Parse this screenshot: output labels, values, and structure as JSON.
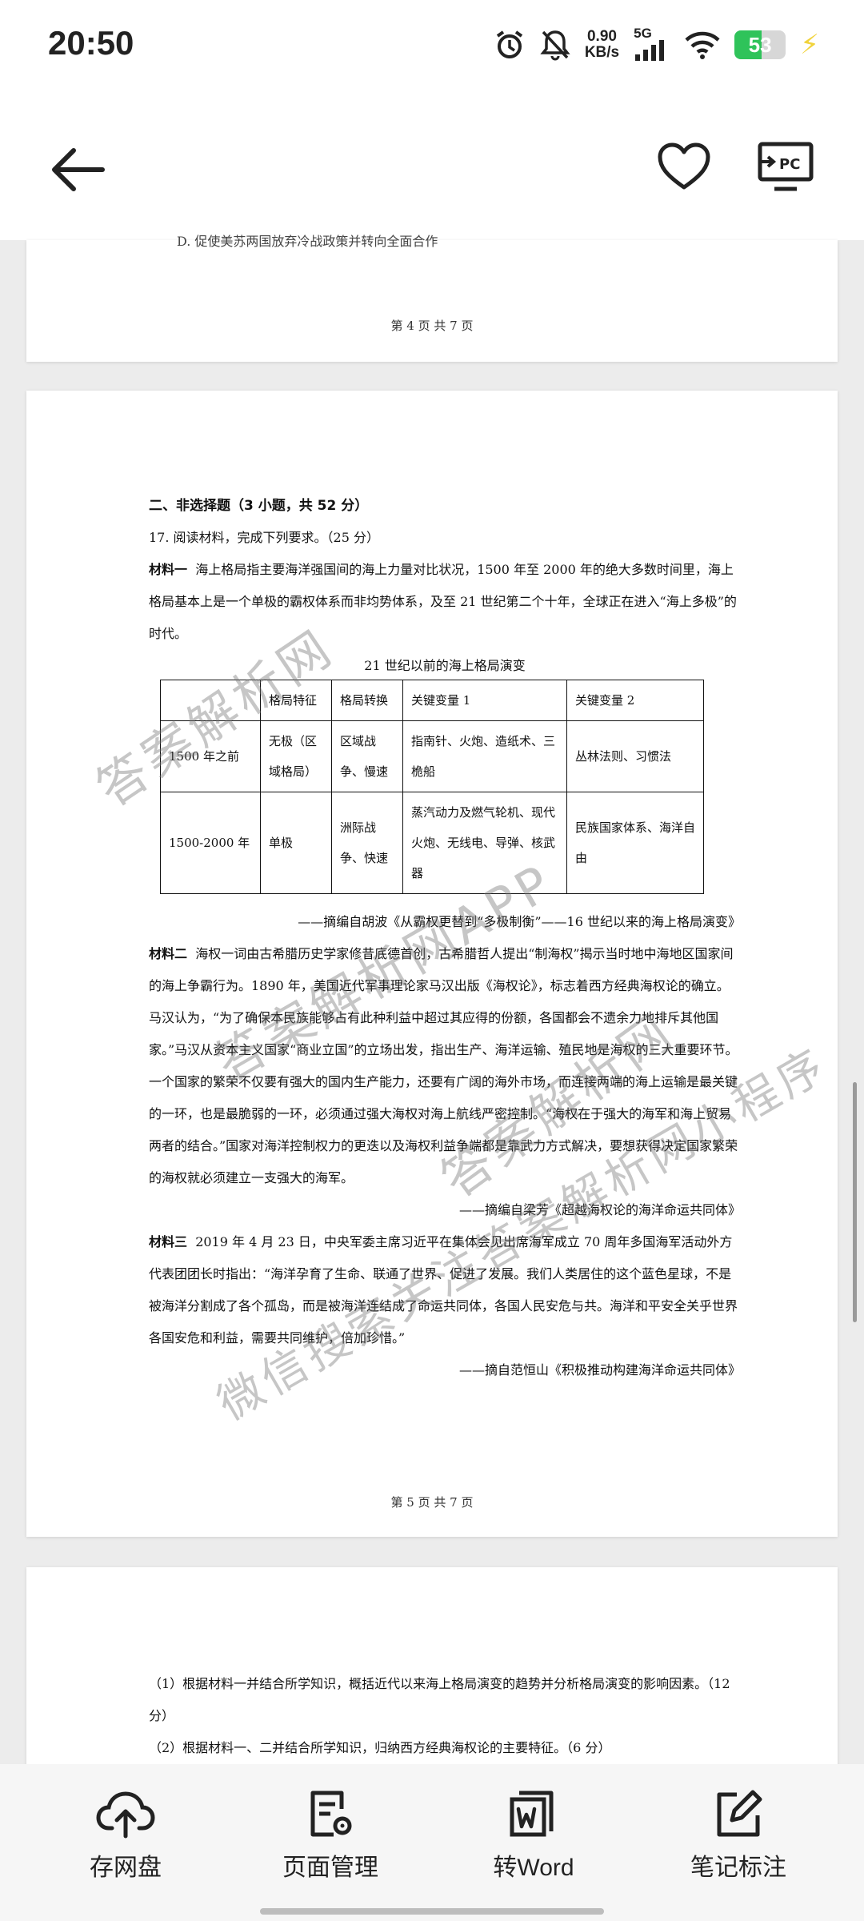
{
  "status_bar": {
    "time": "20:50",
    "net_speed_value": "0.90",
    "net_speed_unit": "KB/s",
    "network": "5G",
    "battery_level": 53,
    "battery_text": "53"
  },
  "page4": {
    "cut_line": "D. 促使美苏两国放弃冷战政策并转向全面合作",
    "footer": "第 4 页 共 7 页"
  },
  "page5": {
    "section": "二、非选择题（3 小题，共 52 分）",
    "question": "17. 阅读材料，完成下列要求。（25 分）",
    "m1_lead": "材料一",
    "m1_text": "海上格局指主要海洋强国间的海上力量对比状况，1500 年至 2000 年的绝大多数时间里，海上格局基本上是一个单极的霸权体系而非均势体系，及至 21 世纪第二个十年，全球正在进入“海上多极”的时代。",
    "table_caption": "21 世纪以前的海上格局演变",
    "table_header": [
      "",
      "格局特征",
      "格局转换",
      "关键变量 1",
      "关键变量 2"
    ],
    "table_rows": [
      [
        "1500 年之前",
        "无极（区域格局）",
        "区域战争、慢速",
        "指南针、火炮、造纸术、三桅船",
        "丛林法则、习惯法"
      ],
      [
        "1500-2000 年",
        "单极",
        "洲际战争、快速",
        "蒸汽动力及燃气轮机、现代火炮、无线电、导弹、核武器",
        "民族国家体系、海洋自由"
      ]
    ],
    "m1_source": "——摘编自胡波《从霸权更替到“多极制衡”——16 世纪以来的海上格局演变》",
    "m2_lead": "材料二",
    "m2_text": "海权一词由古希腊历史学家修昔底德首创，古希腊哲人提出“制海权”揭示当时地中海地区国家间的海上争霸行为。1890 年，美国近代军事理论家马汉出版《海权论》，标志着西方经典海权论的确立。马汉认为，“为了确保本民族能够占有此种利益中超过其应得的份额，各国都会不遗余力地排斥其他国家。”马汉从资本主义国家“商业立国”的立场出发，指出生产、海洋运输、殖民地是海权的三大重要环节。一个国家的繁荣不仅要有强大的国内生产能力，还要有广阔的海外市场，而连接两端的海上运输是最关键的一环，也是最脆弱的一环，必须通过强大海权对海上航线严密控制。“海权在于强大的海军和海上贸易两者的结合。”国家对海洋控制权力的更迭以及海权利益争端都是靠武力方式解决，要想获得决定国家繁荣的海权就必须建立一支强大的海军。",
    "m2_source": "——摘编自梁芳《超越海权论的海洋命运共同体》",
    "m3_lead": "材料三",
    "m3_text": "2019 年 4 月 23 日，中央军委主席习近平在集体会见出席海军成立 70 周年多国海军活动外方代表团团长时指出：“海洋孕育了生命、联通了世界、促进了发展。我们人类居住的这个蓝色星球，不是被海洋分割成了各个孤岛，而是被海洋连结成了命运共同体，各国人民安危与共。海洋和平安全关乎世界各国安危和利益，需要共同维护，倍加珍惜。”",
    "m3_source": "——摘自范恒山《积极推动构建海洋命运共同体》",
    "footer": "第 5 页 共 7 页"
  },
  "page6": {
    "q1": "（1）根据材料一并结合所学知识，概括近代以来海上格局演变的趋势并分析格局演变的影响因素。（12 分）",
    "q2": "（2）根据材料一、二并结合所学知识，归纳西方经典海权论的主要特征。（6 分）"
  },
  "watermarks": [
    "答案解析网",
    "答案解析网APP",
    "微信搜索关注答案解析网小程序",
    "答案解析网"
  ],
  "bottom_bar": {
    "cloud": "存网盘",
    "pages": "页面管理",
    "word": "转Word",
    "notes": "笔记标注"
  }
}
